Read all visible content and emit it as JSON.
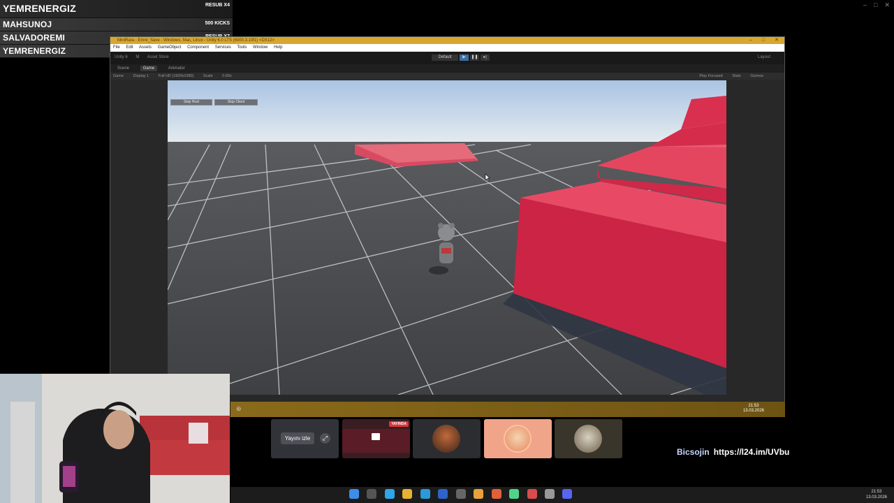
{
  "alerts": [
    {
      "name": "YEMRENERGIZ",
      "event": "RESUB X4"
    },
    {
      "name": "MAHSUNOJ",
      "event": "500 KICKS"
    },
    {
      "name": "SALVADOREMI",
      "event": "RESUB X7"
    },
    {
      "name": "YEMRENERGIZ",
      "event": ""
    }
  ],
  "unity": {
    "title": "MiniRara - Emre_Save - Windows, Mac, Linux - Unity 6.0 LTS (6000.3.10f1) <DX12>",
    "menu": [
      "File",
      "Edit",
      "Assets",
      "GameObject",
      "Component",
      "Services",
      "Tools",
      "Window",
      "Help"
    ],
    "toolbar_left": [
      "Unity 6",
      "M",
      "Asset Store"
    ],
    "toolbar_right": "Layout",
    "play_mode": "Default",
    "tabs": [
      "Scene",
      "Game",
      "Animator"
    ],
    "game_bar": [
      "Game",
      "Display 1",
      "Full HD (1920x1080)",
      "Scale",
      "0.83x"
    ],
    "game_bar_right": [
      "Play Focused",
      "Stats",
      "Gizmos"
    ],
    "viewport_buttons": [
      "Stop Host",
      "Stop Client"
    ]
  },
  "inner_clock": {
    "time": "21:53",
    "date": "13.03.2026"
  },
  "call": {
    "watch_label": "Yayını izle",
    "live_label": "YAYINDA"
  },
  "promo": {
    "handle": "Bicsojin",
    "url": "https://l24.im/UVbu"
  },
  "taskbar_clock": {
    "time": "21:53",
    "date": "13.03.2026"
  },
  "colors": {
    "unity_title": "#d8a72e",
    "platform": "#e0405a",
    "live": "#da373c"
  }
}
